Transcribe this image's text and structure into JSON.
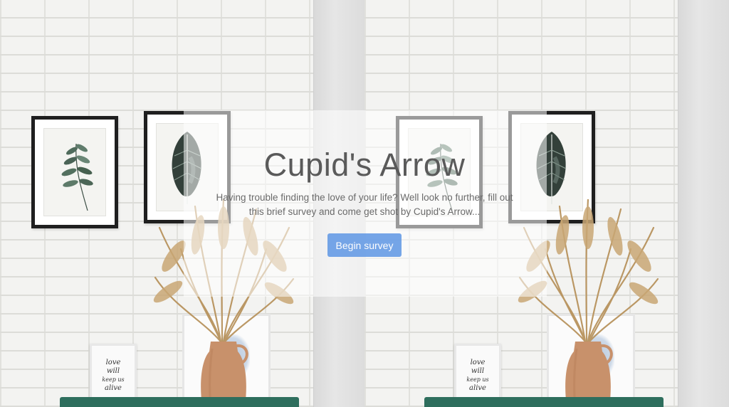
{
  "hero": {
    "title": "Cupid's Arrow",
    "subtitle": "Having trouble finding the love of your life? Well look no further, fill out this brief survey and come get shot by Cupid's Arrow...",
    "begin_button": "Begin survey",
    "background_image": "white-brick-wall-with-framed-botanical-prints-and-pampas-grass-vase",
    "print_text": [
      "love",
      "will",
      "keep us",
      "alive"
    ]
  },
  "colors": {
    "button": "#6a9ee6",
    "title": "#5a5a5a",
    "table": "#2e6e5d",
    "vase": "#c8916b"
  }
}
